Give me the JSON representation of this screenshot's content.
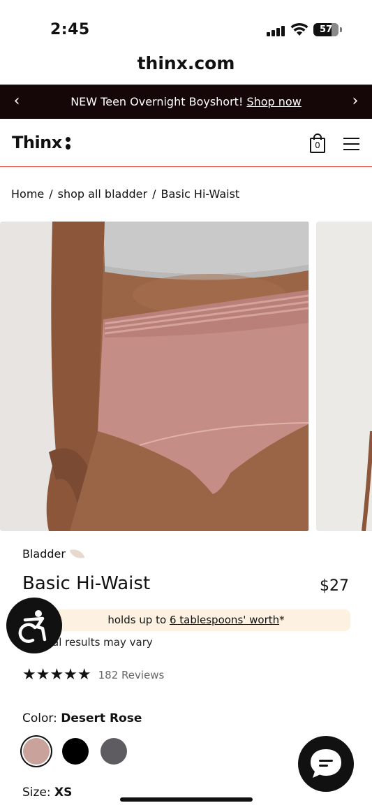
{
  "status": {
    "time": "2:45",
    "battery": "57"
  },
  "browser": {
    "url": "thinx.com"
  },
  "promo": {
    "text": "NEW Teen Overnight Boyshort!",
    "link": "Shop now"
  },
  "header": {
    "logo": "Thinx",
    "cart_count": "0"
  },
  "breadcrumb": {
    "items": [
      "Home",
      "shop all bladder",
      "Basic Hi-Waist"
    ],
    "separator": "/"
  },
  "product": {
    "category": "Bladder",
    "title": "Basic Hi-Waist",
    "price": "$27",
    "absorbency_prefix": "holds up to ",
    "absorbency_link": "6 tablespoons' worth",
    "absorbency_suffix": "*",
    "disclaimer": "dual results may vary",
    "rating_stars": "★★★★★",
    "rating_value": 5,
    "reviews": "182 Reviews",
    "color_label": "Color:",
    "color_value": "Desert Rose",
    "swatches": [
      {
        "name": "Desert Rose",
        "color": "#c9a39b",
        "selected": true
      },
      {
        "name": "Black",
        "color": "#000000",
        "selected": false
      },
      {
        "name": "Gray",
        "color": "#5f5c61",
        "selected": false
      }
    ],
    "size_label": "Size:",
    "size_value": "XS"
  },
  "colors": {
    "promo_bg": "#150707",
    "header_rule": "#e23b3b",
    "pill_bg": "#fdf1e1",
    "fab_bg": "#111111"
  },
  "icons": {
    "promo_prev": "chevron-left-icon",
    "promo_next": "chevron-right-icon",
    "cart": "shopping-bag-icon",
    "menu": "hamburger-menu-icon",
    "accessibility": "accessibility-icon",
    "chat": "chat-bubble-icon"
  }
}
